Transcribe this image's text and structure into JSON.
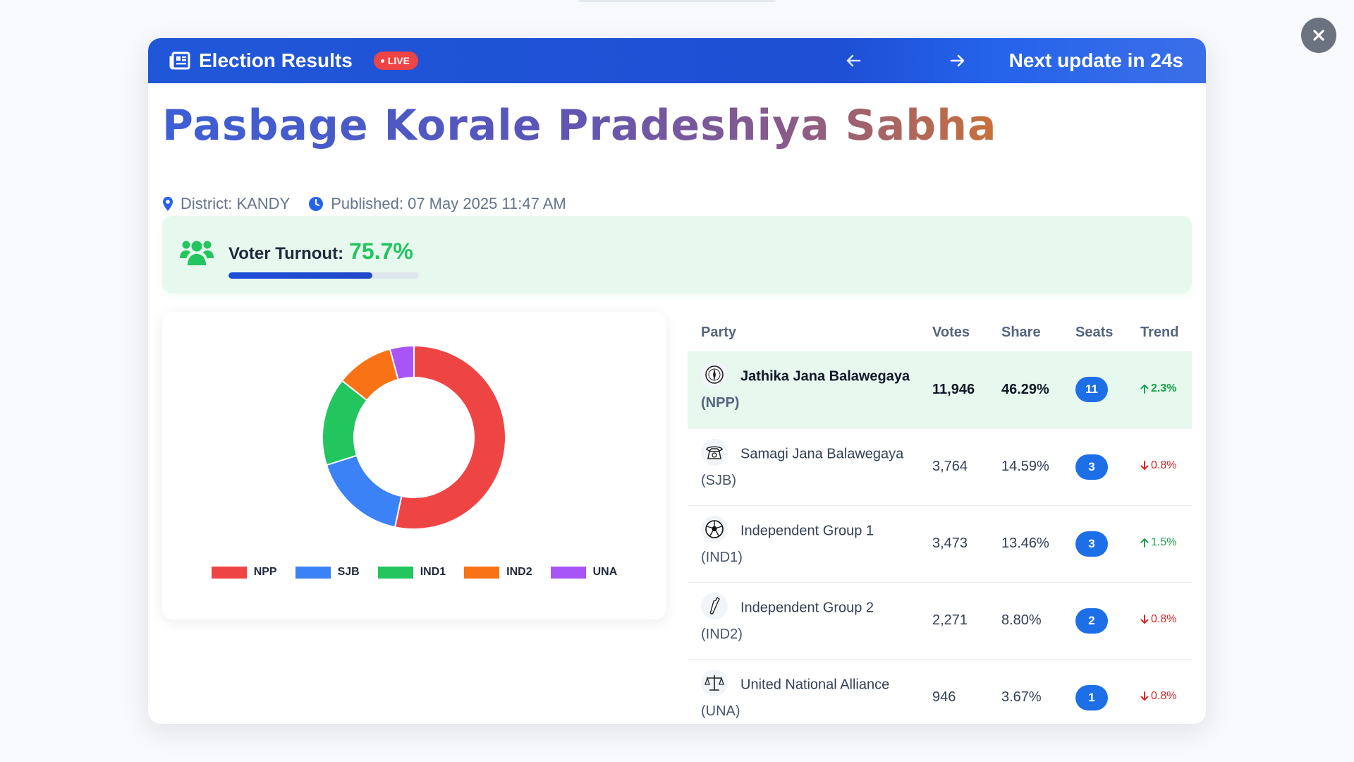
{
  "header": {
    "title": "Election Results",
    "live_label": "LIVE",
    "next_update": "Next update in 24s"
  },
  "page": {
    "title": "Pasbage Korale Pradeshiya Sabha",
    "district": "District: KANDY",
    "published": "Published: 07 May 2025 11:47 AM"
  },
  "turnout": {
    "label": "Voter Turnout:",
    "value": "75.7%",
    "fraction": 0.757
  },
  "icons": {
    "header": "newspaper-icon",
    "prev": "arrow-left-icon",
    "next": "arrow-right-icon",
    "close": "close-icon",
    "district": "map-pin-icon",
    "published": "clock-icon",
    "turnout": "users-icon"
  },
  "colors": {
    "header_blue": "#2057d8",
    "live_red": "#ef4444",
    "turnout_green": "#22c55e",
    "seat_blue": "#1d6fe8",
    "trend_up": "#16a34a",
    "trend_down": "#dc2626"
  },
  "chart_data": {
    "type": "pie",
    "donut": true,
    "categories": [
      "NPP",
      "SJB",
      "IND1",
      "IND2",
      "UNA"
    ],
    "values": [
      46.29,
      14.59,
      13.46,
      8.8,
      3.67
    ],
    "colors": [
      "#ef4444",
      "#3b82f6",
      "#22c55e",
      "#f97316",
      "#a855f7"
    ],
    "legend_position": "bottom"
  },
  "table": {
    "headers": [
      "Party",
      "Votes",
      "Share",
      "Seats",
      "Trend"
    ],
    "rows": [
      {
        "name": "Jathika Jana Balawegaya",
        "abbr": "(NPP)",
        "icon": "compass-icon",
        "votes": "11,946",
        "share": "46.29%",
        "seats": "11",
        "trend": "2.3%",
        "direction": "up",
        "leading": true
      },
      {
        "name": "Samagi Jana Balawegaya",
        "abbr": "(SJB)",
        "icon": "telephone-icon",
        "votes": "3,764",
        "share": "14.59%",
        "seats": "3",
        "trend": "0.8%",
        "direction": "down",
        "leading": false
      },
      {
        "name": "Independent Group 1",
        "abbr": "(IND1)",
        "icon": "football-icon",
        "votes": "3,473",
        "share": "13.46%",
        "seats": "3",
        "trend": "1.5%",
        "direction": "up",
        "leading": false
      },
      {
        "name": "Independent Group 2",
        "abbr": "(IND2)",
        "icon": "bottle-icon",
        "votes": "2,271",
        "share": "8.80%",
        "seats": "2",
        "trend": "0.8%",
        "direction": "down",
        "leading": false
      },
      {
        "name": "United National Alliance",
        "abbr": "(UNA)",
        "icon": "scales-icon",
        "votes": "946",
        "share": "3.67%",
        "seats": "1",
        "trend": "0.8%",
        "direction": "down",
        "leading": false
      }
    ]
  }
}
